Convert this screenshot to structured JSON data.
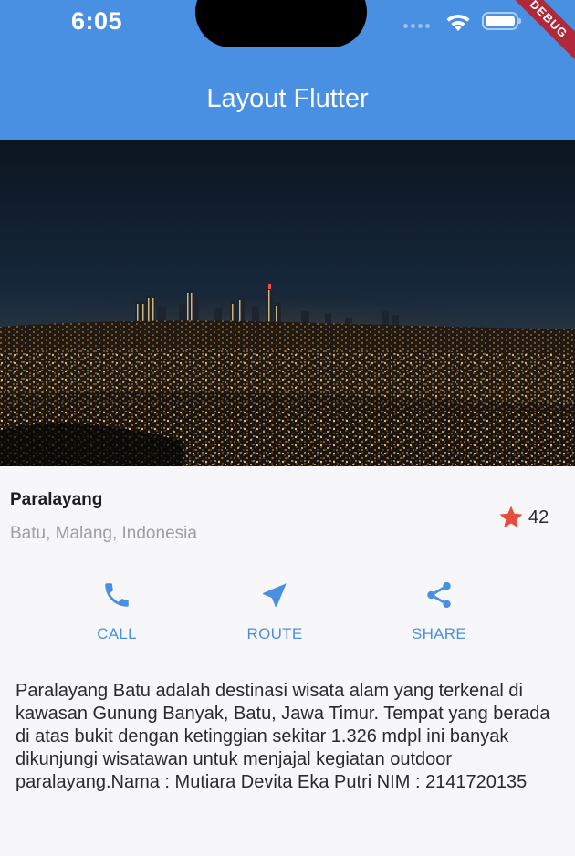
{
  "status_bar": {
    "time": "6:05",
    "debug_label": "DEBUG"
  },
  "app_bar": {
    "title": "Layout Flutter",
    "color": "#4a90e2"
  },
  "hero_image": {
    "icon": "city-night-skyline-image"
  },
  "title_section": {
    "name": "Paralayang",
    "location": "Batu, Malang, Indonesia",
    "rating_icon": "star-icon",
    "rating_color": "#e74c3c",
    "rating_count": "42"
  },
  "actions": [
    {
      "label": "CALL",
      "icon": "phone-icon"
    },
    {
      "label": "ROUTE",
      "icon": "navigation-icon"
    },
    {
      "label": "SHARE",
      "icon": "share-icon"
    }
  ],
  "accent_color": "#4a90e2",
  "description": "Paralayang Batu adalah destinasi wisata alam yang terkenal di kawasan Gunung Banyak, Batu, Jawa Timur. Tempat yang berada di atas bukit dengan ketinggian sekitar 1.326 mdpl ini banyak dikunjungi wisatawan untuk menjajal kegiatan outdoor paralayang.Nama : Mutiara Devita Eka Putri NIM : 2141720135"
}
